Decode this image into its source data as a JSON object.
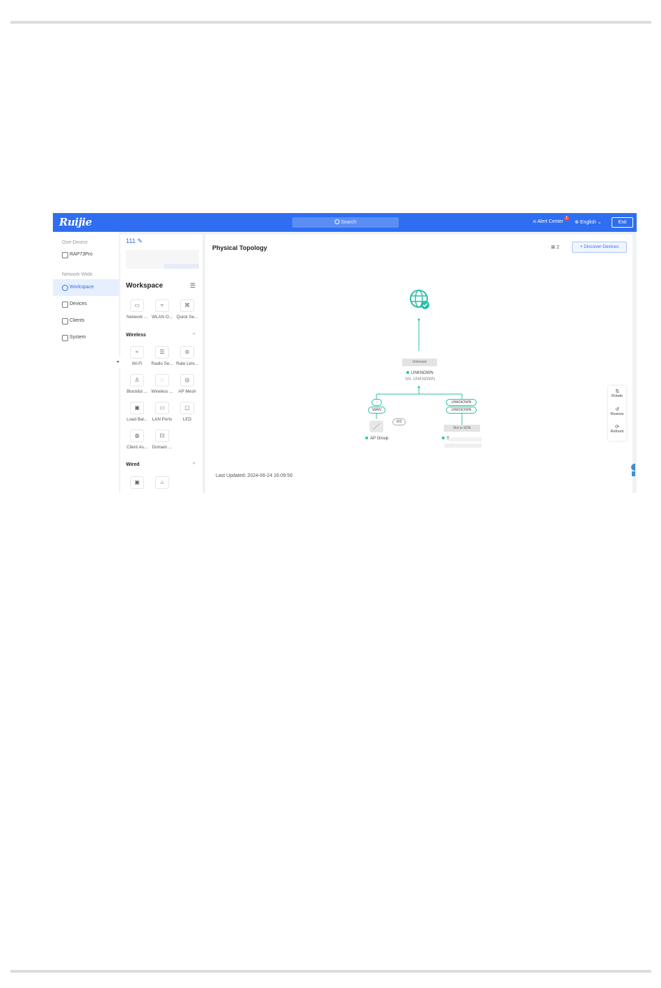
{
  "header": {
    "logo": "Ruijie",
    "search_label": "Search",
    "alert_center": "Alert Center",
    "alert_count": "1",
    "language": "English",
    "exit": "Exit"
  },
  "nav": {
    "one_device_title": "One-Device",
    "device_name": "RAP73Pro",
    "network_wide_title": "Network-Wide",
    "items": [
      {
        "label": "Workspace",
        "icon": "workspace-icon"
      },
      {
        "label": "Devices",
        "icon": "devices-icon"
      },
      {
        "label": "Clients",
        "icon": "clients-icon"
      },
      {
        "label": "System",
        "icon": "system-icon"
      }
    ]
  },
  "workspace": {
    "network_name": "111",
    "title": "Workspace",
    "top_tiles": [
      "Network ...",
      "WLAN O...",
      "Quick Se..."
    ],
    "wireless_title": "Wireless",
    "wireless_tiles": [
      "Wi-Fi",
      "Radio Se...",
      "Rate Limi...",
      "Blocklist ...",
      "Wireless ...",
      "AP Mesh",
      "Load Bal...",
      "LAN Ports",
      "LED",
      "Client As...",
      "Domain ..."
    ],
    "wired_title": "Wired"
  },
  "topology": {
    "title": "Physical Topology",
    "alarm_count": "2",
    "discover_button": "+ Discover Devices",
    "gateway_box": "Unknown",
    "gateway_name": "UNKNOWN",
    "gateway_sn": "SN: UNKNOWN",
    "left_port_top": "-",
    "left_port_bottom": "WAN",
    "ap_count": "0/2",
    "ap_group": "AP Group",
    "right_port_top": "UNKNOWN",
    "right_port_bottom": "UNKNOWN",
    "not_in_sdn": "Not in SDN",
    "right_device": "S",
    "last_updated": "Last Updated: 2024-06-24 16:09:50",
    "tools": [
      "Rotate",
      "Restore",
      "Refresh"
    ]
  },
  "colors": {
    "primary": "#2f6ef1",
    "topology_line": "#2bbfa8",
    "alert": "#ff4d4f"
  }
}
